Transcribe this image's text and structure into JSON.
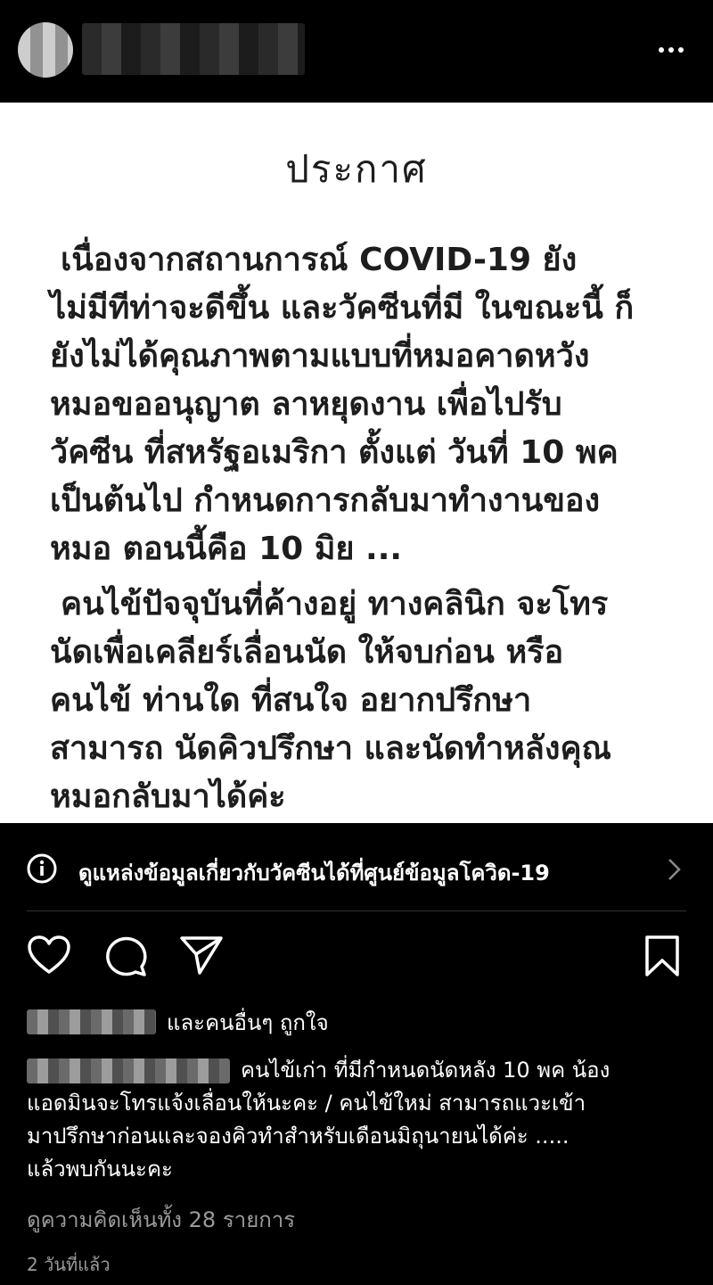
{
  "header": {
    "more_label": "•••"
  },
  "post": {
    "title": "ประกาศ",
    "paragraph1": [
      "เนื่องจากสถานการณ์ COVID-19 ยัง",
      "ไม่มีทีท่าจะดีขึ้น และวัคซีนที่มี ในขณะนี้ ก็",
      "ยังไม่ได้คุณภาพตามแบบที่หมอคาดหวัง",
      "หมอขออนุญาต ลาหยุดงาน เพื่อไปรับ",
      "วัคซีน ที่สหรัฐอเมริกา ตั้งแต่ วันที่ 10 พค",
      "เป็นต้นไป  กำหนดการกลับมาทำงานของ",
      "หมอ ตอนนี้คือ 10 มิย ..."
    ],
    "paragraph2": [
      "คนไข้ปัจจุบันที่ค้างอยู่ ทางคลินิก จะโทร",
      "นัดเพื่อเคลียร์เลื่อนนัด ให้จบก่อน หรือ",
      "คนไข้ ท่านใด ที่สนใจ อยากปรึกษา",
      "สามารถ นัดคิวปรึกษา และนัดทำหลังคุณ",
      "หมอกลับมาได้ค่ะ"
    ]
  },
  "info_banner": {
    "text": "ดูแหล่งข้อมูลเกี่ยวกับวัคซีนได้ที่ศูนย์ข้อมูลโควิด-19"
  },
  "likes": {
    "text": "และคนอื่นๆ ถูกใจ"
  },
  "caption": {
    "lines": [
      "คนไข้เก่า ที่มีกำหนดนัดหลัง 10 พค น้อง",
      "แอดมินจะโทรแจ้งเลื่อนให้นะคะ / คนไข้ใหม่ สามารถแวะเข้า",
      "มาปรึกษาก่อนและจองคิวทำสำหรับเดือนมิถุนายนได้ค่ะ .....",
      "แล้วพบกันนะคะ"
    ]
  },
  "view_comments": "ดูความคิดเห็นทั้ง 28 รายการ",
  "timestamp": "2 วันที่แล้ว",
  "icons": {
    "info": "info-icon",
    "chevron": "chevron-right-icon",
    "like": "heart-icon",
    "comment": "comment-icon",
    "share": "send-icon",
    "save": "bookmark-icon"
  }
}
